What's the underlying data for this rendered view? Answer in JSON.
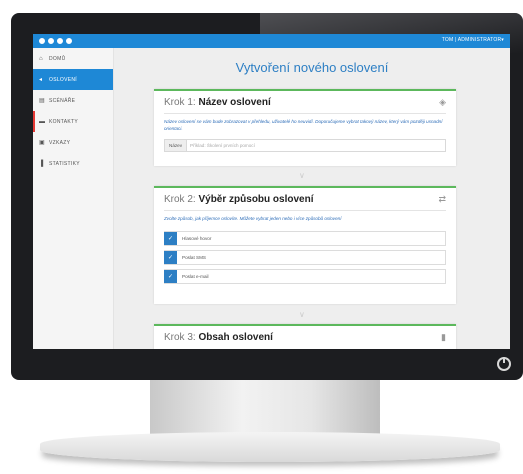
{
  "app": {
    "user_menu": "TOM | ADMINISTRATOR▾"
  },
  "sidebar": {
    "items": [
      {
        "icon": "home-icon",
        "glyph": "⌂",
        "label": "DOMŮ"
      },
      {
        "icon": "megaphone-icon",
        "glyph": "◂",
        "label": "OSLOVENÍ"
      },
      {
        "icon": "file-icon",
        "glyph": "▤",
        "label": "SCÉNÁŘE"
      },
      {
        "icon": "folder-icon",
        "glyph": "▬",
        "label": "KONTAKTY"
      },
      {
        "icon": "message-icon",
        "glyph": "▣",
        "label": "VZKAZY"
      },
      {
        "icon": "chart-icon",
        "glyph": "▐",
        "label": "STATISTIKY"
      }
    ]
  },
  "main": {
    "title": "Vytvoření nového oslovení",
    "step1": {
      "krok": "Krok 1:",
      "name": "Název oslovení",
      "icon": "tag-icon",
      "hint": "Název oslovení se vám bude zobrazovat v přehledu, uživatelé ho neuvidí. Doporučujeme vybrat takový název, který vám později usnadní orientaci.",
      "addon": "Název",
      "placeholder": "Příklad: Školení prvních pomocí"
    },
    "step2": {
      "krok": "Krok 2:",
      "name": "Výběr způsobu oslovení",
      "icon": "shuffle-icon",
      "hint": "Zvolte způsob, jak příjemce oslovíte. Můžete vybrat jeden nebo i více způsobů oslovení",
      "options": [
        "Hlasové hovor",
        "Poslat SMS",
        "Poslat e-mail"
      ]
    },
    "step3": {
      "krok": "Krok 3:",
      "name": "Obsah oslovení",
      "icon": "document-icon"
    }
  }
}
